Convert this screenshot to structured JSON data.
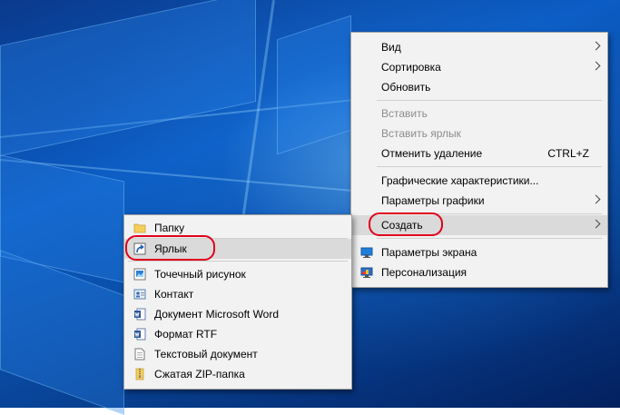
{
  "desktop_menu": {
    "items": [
      {
        "label": "Вид"
      },
      {
        "label": "Сортировка"
      },
      {
        "label": "Обновить"
      },
      {
        "label": "Вставить"
      },
      {
        "label": "Вставить ярлык"
      },
      {
        "label": "Отменить удаление",
        "shortcut": "CTRL+Z"
      },
      {
        "label": "Графические характеристики..."
      },
      {
        "label": "Параметры графики"
      },
      {
        "label": "Создать"
      },
      {
        "label": "Параметры экрана"
      },
      {
        "label": "Персонализация"
      }
    ]
  },
  "create_submenu": {
    "items": [
      {
        "label": "Папку",
        "icon": "folder-icon"
      },
      {
        "label": "Ярлык",
        "icon": "shortcut-icon"
      },
      {
        "label": "Точечный рисунок",
        "icon": "bitmap-icon"
      },
      {
        "label": "Контакт",
        "icon": "contact-icon"
      },
      {
        "label": "Документ Microsoft Word",
        "icon": "word-document-icon"
      },
      {
        "label": "Формат RTF",
        "icon": "rtf-document-icon"
      },
      {
        "label": "Текстовый документ",
        "icon": "text-document-icon"
      },
      {
        "label": "Сжатая ZIP-папка",
        "icon": "zip-folder-icon"
      }
    ]
  },
  "colors": {
    "highlight_ring": "#e0001b",
    "menu_background": "#f2f2f2",
    "menu_hover": "#dadada"
  }
}
